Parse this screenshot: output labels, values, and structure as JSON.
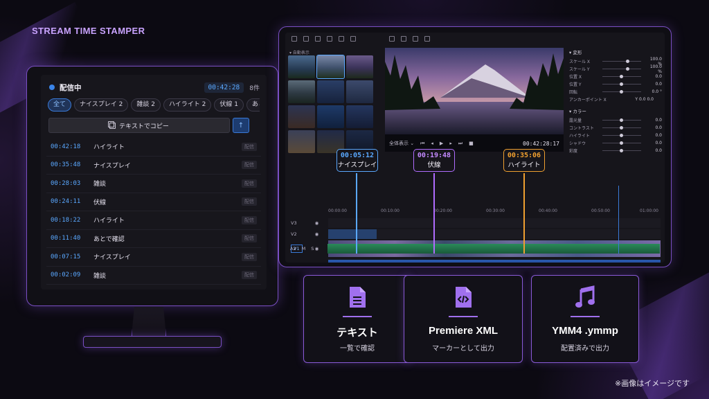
{
  "brand": "STREAM TIME STAMPER",
  "note": "※画像はイメージです",
  "colors": {
    "accent": "#8a5ad8",
    "blue": "#5aa8ff",
    "cyan": "#5aa8ff",
    "purple": "#b06cff",
    "orange": "#f0a030"
  },
  "panel": {
    "title": "配信中",
    "time": "00:42:28",
    "count": "8件",
    "filters": [
      "全て",
      "ナイスプレイ 2",
      "雑談 2",
      "ハイライト 2",
      "伏線 1",
      "あとで確認"
    ],
    "copy_label": "テキストでコピー",
    "up_icon": "↑",
    "rows": [
      {
        "time": "00:42:18",
        "label": "ハイライト",
        "tag": "配信"
      },
      {
        "time": "00:35:48",
        "label": "ナイスプレイ",
        "tag": "配信"
      },
      {
        "time": "00:28:03",
        "label": "雑談",
        "tag": "配信"
      },
      {
        "time": "00:24:11",
        "label": "伏線",
        "tag": "配信"
      },
      {
        "time": "00:18:22",
        "label": "ハイライト",
        "tag": "配信"
      },
      {
        "time": "00:11:40",
        "label": "あとで確認",
        "tag": "配信"
      },
      {
        "time": "00:07:15",
        "label": "ナイスプレイ",
        "tag": "配信"
      },
      {
        "time": "00:02:09",
        "label": "雑談",
        "tag": "配信"
      }
    ]
  },
  "editor": {
    "media_label": "▾ 自動表示",
    "preview_mode": "全体表示 ⌄",
    "preview_time": "00:42:28:17",
    "props": {
      "transform_label": "▾ 変形",
      "transform": [
        {
          "name": "スケール X",
          "value": "100.0 %"
        },
        {
          "name": "スケール Y",
          "value": "100.0 %"
        },
        {
          "name": "位置 X",
          "value": "0.0"
        },
        {
          "name": "位置 Y",
          "value": "0.0"
        },
        {
          "name": "回転",
          "value": "0.0 °"
        },
        {
          "name": "アンカーポイント X",
          "value": "Y  0.0  0.0"
        }
      ],
      "color_label": "▾ カラー",
      "color": [
        {
          "name": "露光量",
          "value": "0.0"
        },
        {
          "name": "コントラスト",
          "value": "0.0"
        },
        {
          "name": "ハイライト",
          "value": "0.0"
        },
        {
          "name": "シャドウ",
          "value": "0.0"
        },
        {
          "name": "彩度",
          "value": "0.0"
        }
      ]
    },
    "ruler": [
      "00:00:00",
      "00:10:00",
      "00:20:00",
      "00:30:00",
      "00:40:00",
      "00:50:00",
      "01:00:00"
    ],
    "tracks": [
      "V3",
      "V2",
      "V1",
      "A1",
      "A2"
    ],
    "audio_flags": [
      "M",
      "S"
    ],
    "markers": [
      {
        "time": "00:05:12",
        "label": "ナイスプレイ"
      },
      {
        "time": "00:19:48",
        "label": "伏線"
      },
      {
        "time": "00:35:06",
        "label": "ハイライト"
      }
    ]
  },
  "cards": [
    {
      "icon": "document-icon",
      "title": "テキスト",
      "subtitle": "一覧で確認"
    },
    {
      "icon": "code-file-icon",
      "title": "Premiere XML",
      "subtitle": "マーカーとして出力"
    },
    {
      "icon": "music-note-icon",
      "title": "YMM4 .ymmp",
      "subtitle": "配置済みで出力"
    }
  ]
}
